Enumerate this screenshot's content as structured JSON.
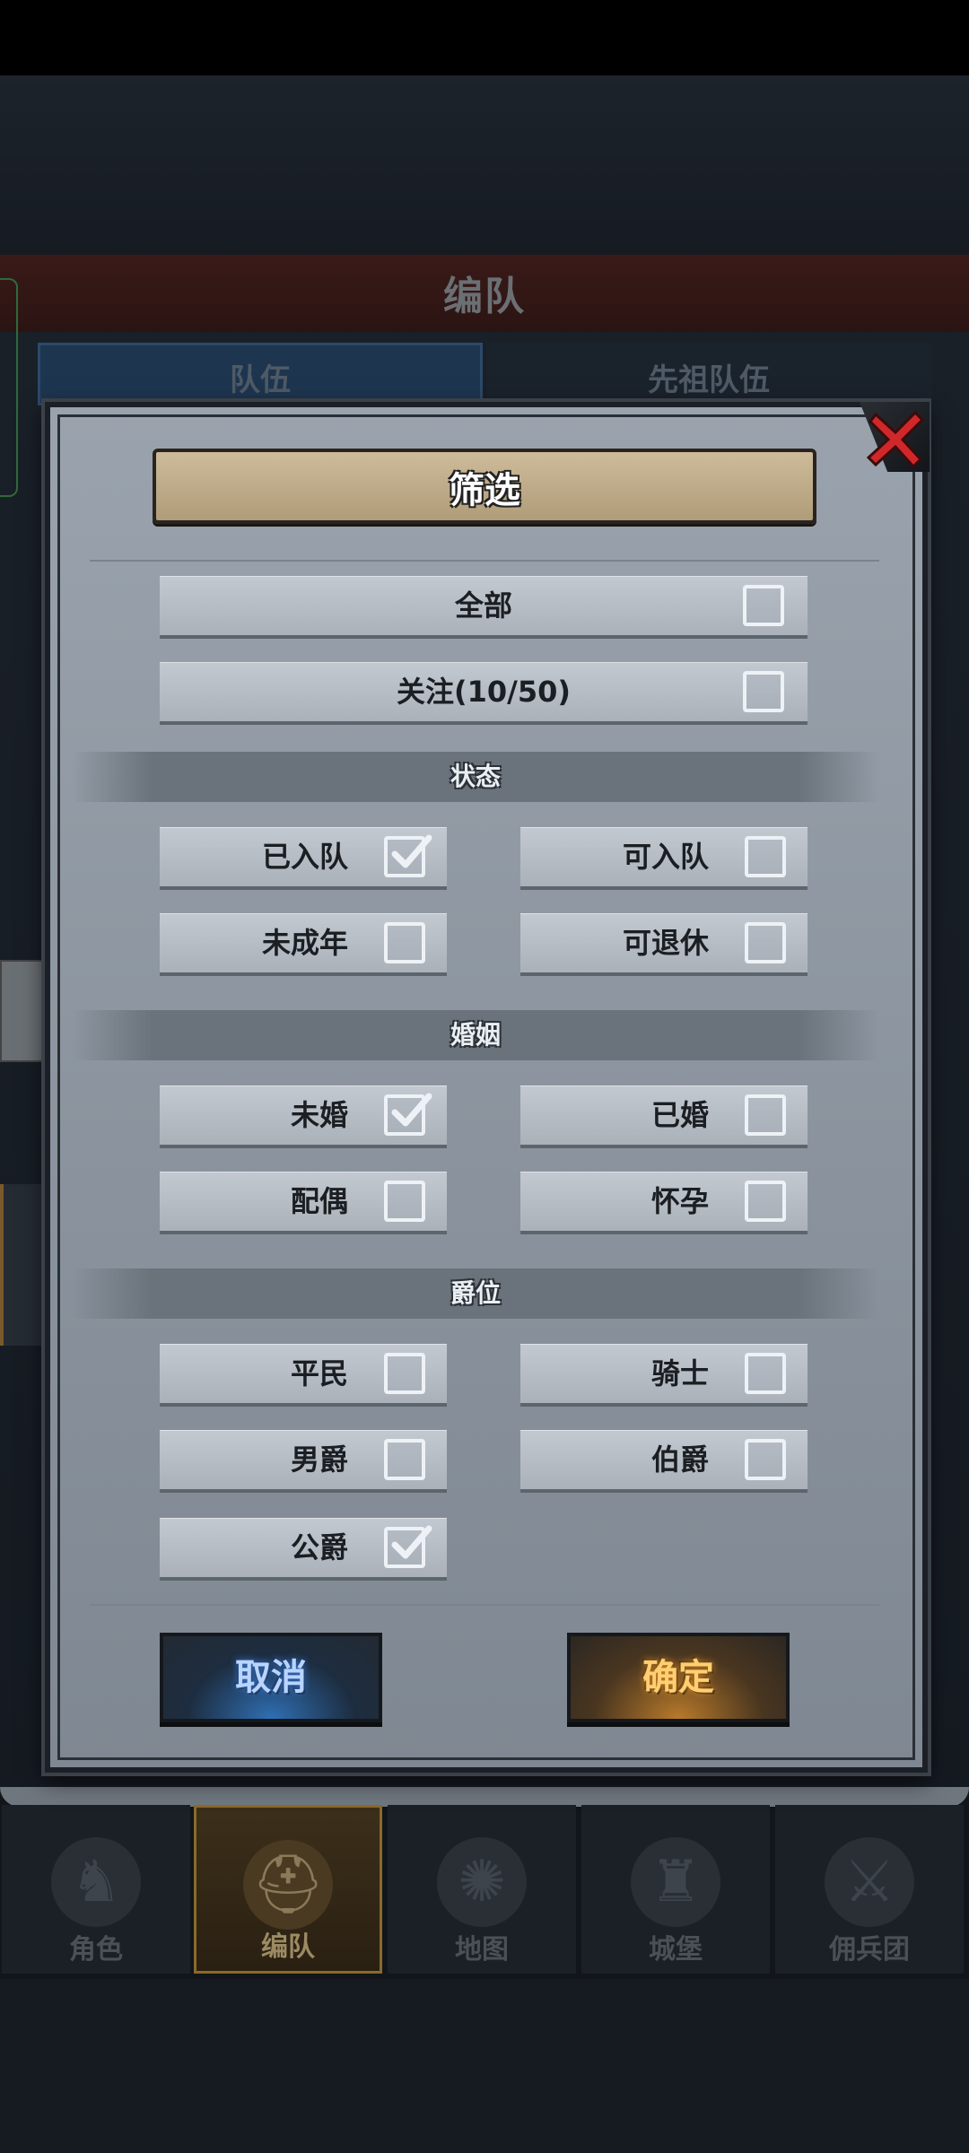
{
  "background": {
    "screen_title": "编队",
    "tabs": [
      "队伍",
      "先祖队伍"
    ]
  },
  "bottom_nav": [
    {
      "label": "角色",
      "icon": "knight-icon",
      "active": false
    },
    {
      "label": "编队",
      "icon": "helmet-icon",
      "active": true
    },
    {
      "label": "地图",
      "icon": "compass-map-icon",
      "active": false
    },
    {
      "label": "城堡",
      "icon": "castle-icon",
      "active": false
    },
    {
      "label": "佣兵团",
      "icon": "mercenary-icon",
      "active": false
    }
  ],
  "modal": {
    "title": "筛选",
    "close_icon": "close-icon",
    "top_options": [
      {
        "label": "全部",
        "checked": false
      },
      {
        "label": "关注(10/50)",
        "checked": false
      }
    ],
    "sections": [
      {
        "title": "状态",
        "options": [
          {
            "label": "已入队",
            "checked": true
          },
          {
            "label": "可入队",
            "checked": false
          },
          {
            "label": "未成年",
            "checked": false
          },
          {
            "label": "可退休",
            "checked": false
          }
        ]
      },
      {
        "title": "婚姻",
        "options": [
          {
            "label": "未婚",
            "checked": true
          },
          {
            "label": "已婚",
            "checked": false
          },
          {
            "label": "配偶",
            "checked": false
          },
          {
            "label": "怀孕",
            "checked": false
          }
        ]
      },
      {
        "title": "爵位",
        "options": [
          {
            "label": "平民",
            "checked": false
          },
          {
            "label": "骑士",
            "checked": false
          },
          {
            "label": "男爵",
            "checked": false
          },
          {
            "label": "伯爵",
            "checked": false
          },
          {
            "label": "公爵",
            "checked": true
          }
        ]
      }
    ],
    "cancel_label": "取消",
    "confirm_label": "确定"
  },
  "colors": {
    "check_color": "#eef2f6",
    "cancel_glow": "#2f6fb4",
    "confirm_glow": "#b97a2a",
    "close_red": "#d0282a"
  }
}
